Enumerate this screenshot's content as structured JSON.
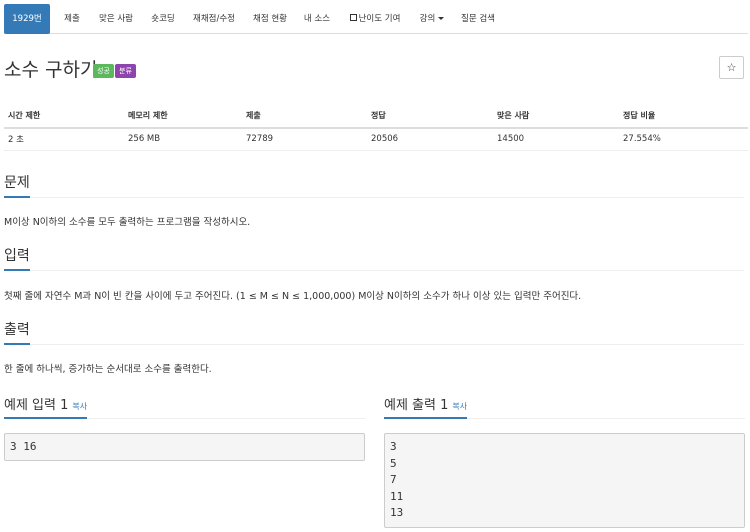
{
  "nav": {
    "items": [
      {
        "label": "1929번"
      },
      {
        "label": "제출"
      },
      {
        "label": "맞은 사람"
      },
      {
        "label": "숏코딩"
      },
      {
        "label": "재채점/수정"
      },
      {
        "label": "채점 현황"
      },
      {
        "label": "내 소스"
      },
      {
        "label": "난이도 기여"
      },
      {
        "label": "강의"
      },
      {
        "label": "질문 검색"
      }
    ]
  },
  "problem": {
    "title": "소수 구하기",
    "labels": [
      "성공",
      "분류"
    ],
    "star": "☆"
  },
  "info": {
    "headers": [
      "시간 제한",
      "메모리 제한",
      "제출",
      "정답",
      "맞은 사람",
      "정답 비율"
    ],
    "values": [
      "2 초",
      "256 MB",
      "72789",
      "20506",
      "14500",
      "27.554%"
    ]
  },
  "sections": [
    {
      "heading": "문제",
      "text": "M이상 N이하의 소수를 모두 출력하는 프로그램을 작성하시오."
    },
    {
      "heading": "입력",
      "text": "첫째 줄에 자연수 M과 N이 빈 칸을 사이에 두고 주어진다. (1 ≤ M ≤ N ≤ 1,000,000) M이상 N이하의 소수가 하나 이상 있는 입력만 주어진다."
    },
    {
      "heading": "출력",
      "text": "한 줄에 하나씩, 증가하는 순서대로 소수를 출력한다."
    }
  ],
  "samples": {
    "input": {
      "heading": "예제 입력 1",
      "copy": "복사",
      "content": "3 16"
    },
    "output": {
      "heading": "예제 출력 1",
      "copy": "복사",
      "content": "3\n5\n7\n11\n13"
    }
  }
}
